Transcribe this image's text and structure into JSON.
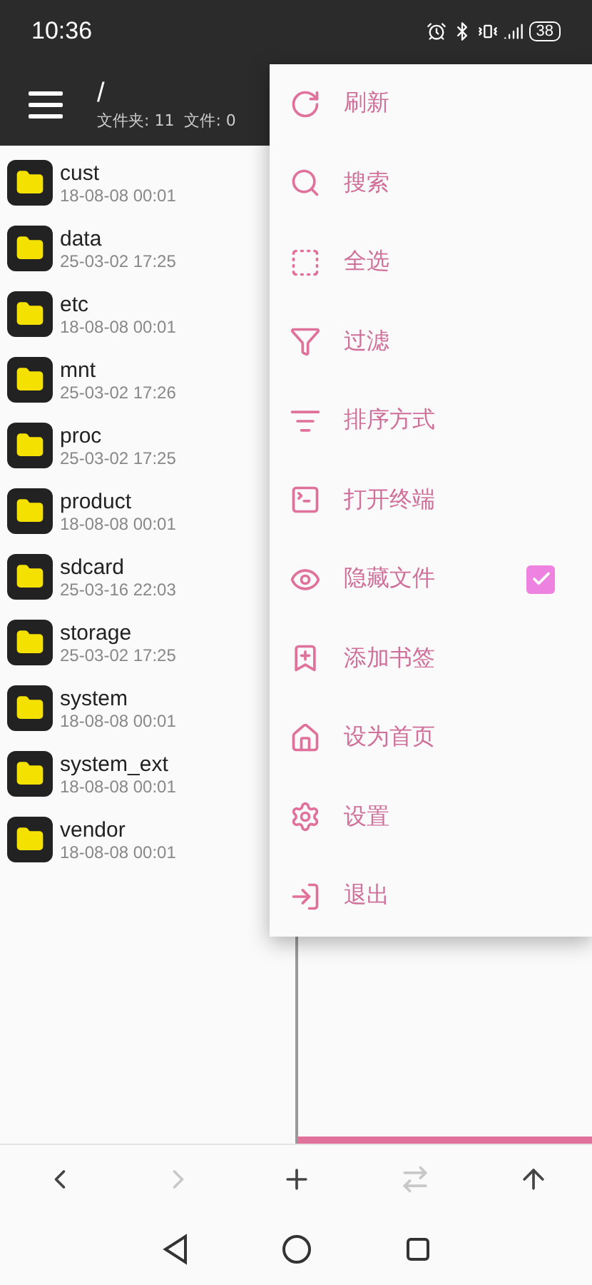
{
  "status_bar": {
    "time": "10:36",
    "battery": "38"
  },
  "toolbar": {
    "path": "/",
    "summary": "文件夹: 11  文件: 0"
  },
  "files": [
    {
      "name": "cust",
      "date": "18-08-08 00:01"
    },
    {
      "name": "data",
      "date": "25-03-02 17:25"
    },
    {
      "name": "etc",
      "date": "18-08-08 00:01"
    },
    {
      "name": "mnt",
      "date": "25-03-02 17:26"
    },
    {
      "name": "proc",
      "date": "25-03-02 17:25"
    },
    {
      "name": "product",
      "date": "18-08-08 00:01"
    },
    {
      "name": "sdcard",
      "date": "25-03-16 22:03"
    },
    {
      "name": "storage",
      "date": "25-03-02 17:25"
    },
    {
      "name": "system",
      "date": "18-08-08 00:01"
    },
    {
      "name": "system_ext",
      "date": "18-08-08 00:01"
    },
    {
      "name": "vendor",
      "date": "18-08-08 00:01"
    }
  ],
  "menu": [
    {
      "kind": "refresh",
      "label": "刷新"
    },
    {
      "kind": "search",
      "label": "搜索"
    },
    {
      "kind": "select_all",
      "label": "全选"
    },
    {
      "kind": "filter",
      "label": "过滤"
    },
    {
      "kind": "sort",
      "label": "排序方式"
    },
    {
      "kind": "terminal",
      "label": "打开终端"
    },
    {
      "kind": "hidden",
      "label": "隐藏文件",
      "checked": true
    },
    {
      "kind": "bookmark",
      "label": "添加书签"
    },
    {
      "kind": "home",
      "label": "设为首页"
    },
    {
      "kind": "settings",
      "label": "设置"
    },
    {
      "kind": "exit",
      "label": "退出"
    }
  ],
  "bottom_bar": [
    {
      "kind": "back",
      "disabled": false
    },
    {
      "kind": "forward",
      "disabled": true
    },
    {
      "kind": "add",
      "disabled": false
    },
    {
      "kind": "swap",
      "disabled": true
    },
    {
      "kind": "up",
      "disabled": false
    }
  ]
}
